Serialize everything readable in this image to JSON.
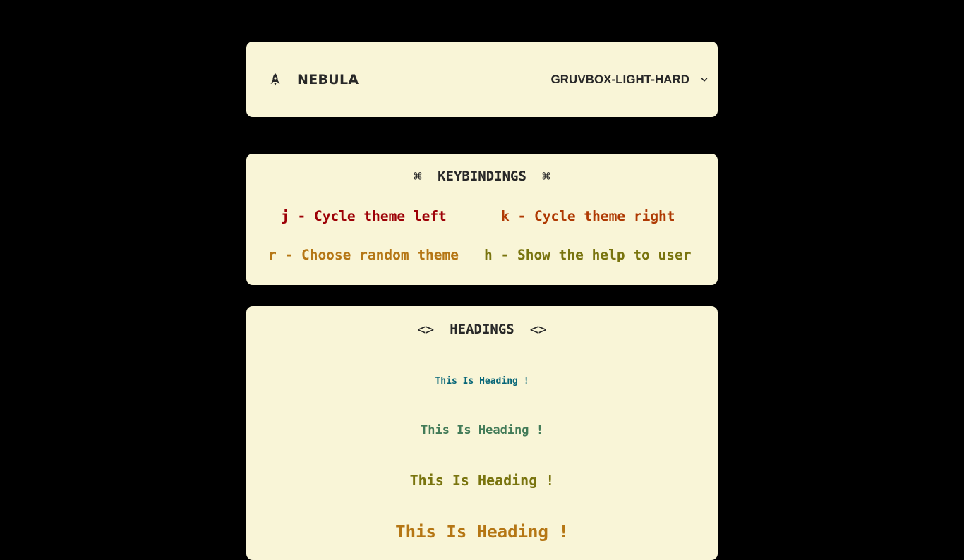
{
  "navbar": {
    "brand": "NEBULA",
    "brand_icon": "rocket-icon",
    "theme": "GRUVBOX-LIGHT-HARD",
    "theme_icon": "chevron-down-icon"
  },
  "keybindings": {
    "title": "KEYBINDINGS",
    "title_icon": "⌘",
    "items": [
      {
        "text": "j - Cycle theme left",
        "color": "#9d0006"
      },
      {
        "text": "k - Cycle theme right",
        "color": "#af3a03"
      },
      {
        "text": "r - Choose random theme",
        "color": "#b57614"
      },
      {
        "text": "h - Show the help to user",
        "color": "#79740e"
      }
    ]
  },
  "headings": {
    "title": "HEADINGS",
    "title_icon": "<>",
    "items": [
      {
        "text": "This Is Heading !",
        "color": "#076678"
      },
      {
        "text": "This Is Heading !",
        "color": "#427b58"
      },
      {
        "text": "This Is Heading !",
        "color": "#79740e"
      },
      {
        "text": "This Is Heading !",
        "color": "#b57614"
      }
    ]
  },
  "colors": {
    "page_background": "#000000",
    "card_background": "#f9f5d7",
    "foreground": "#282828"
  }
}
